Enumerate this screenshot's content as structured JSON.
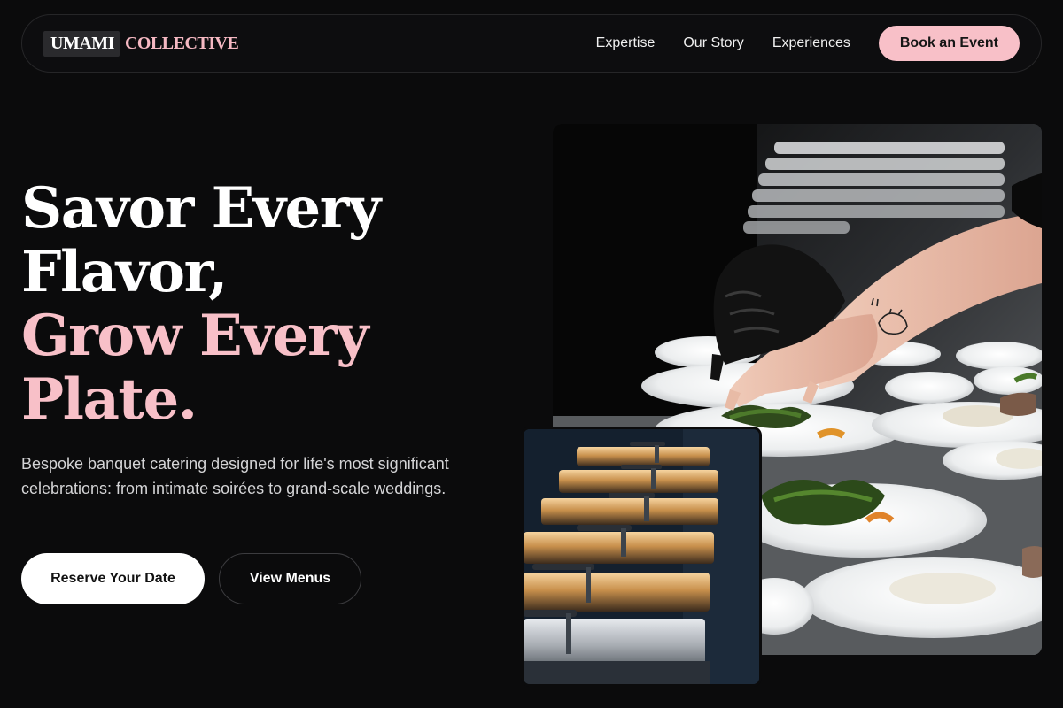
{
  "nav": {
    "logo_primary": "UMAMI",
    "logo_accent": "COLLECTIVE",
    "links": [
      "Expertise",
      "Our Story",
      "Experiences"
    ],
    "cta": "Book an Event"
  },
  "hero": {
    "title_line1": "Savor Every",
    "title_line2": "Flavor,",
    "title_line3": "Grow Every",
    "title_line4": "Plate.",
    "subtitle": "Bespoke banquet catering designed for life's most significant celebrations: from intimate soirées to grand-scale weddings.",
    "primary_cta": "Reserve Your Date",
    "secondary_cta": "View Menus"
  },
  "images": {
    "main_alt": "Chef plating dishes in a commercial kitchen",
    "secondary_alt": "Stainless steel chafing dishes lined up"
  },
  "colors": {
    "accent": "#f8c0c8",
    "background": "#0b0b0c"
  }
}
